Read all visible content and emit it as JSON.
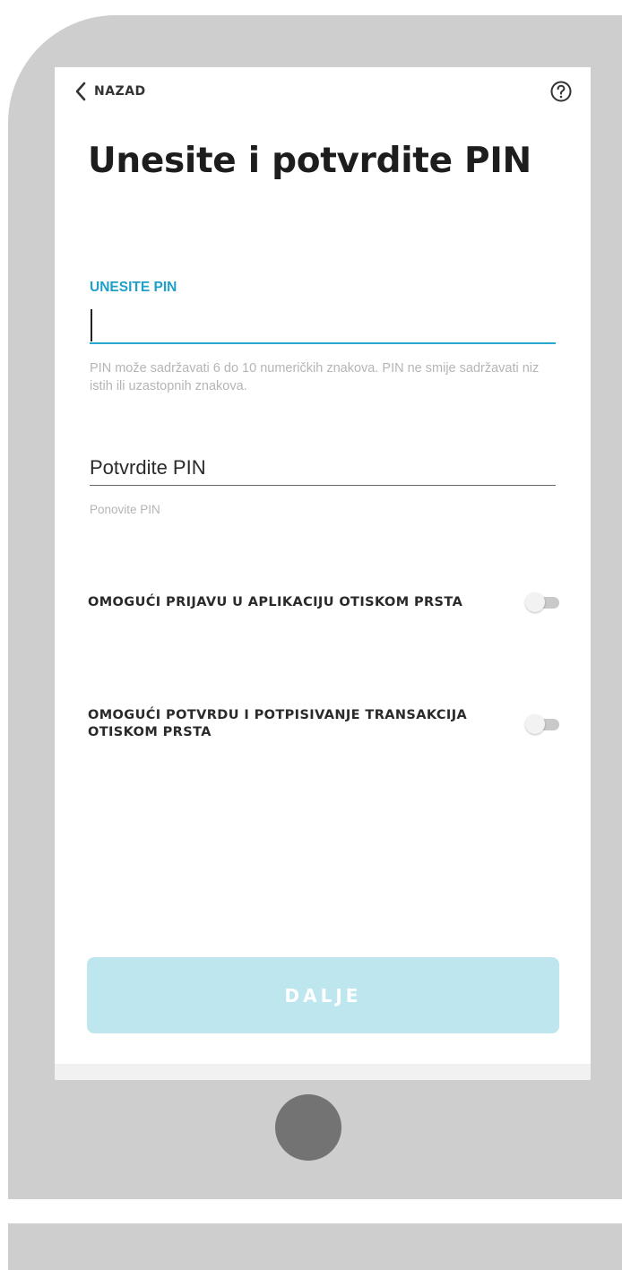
{
  "header": {
    "back_label": "NAZAD",
    "back_icon": "chevron-left-icon",
    "help_icon": "help-circle-icon"
  },
  "page_title": "Unesite i potvrdite PIN",
  "pin_field": {
    "label": "UNESITE PIN",
    "value": "",
    "hint": "PIN može sadržavati 6 do 10 numeričkih znakova. PIN ne smije sadržavati niz istih ili uzastopnih znakova."
  },
  "confirm_field": {
    "placeholder": "Potvrdite PIN",
    "value": "",
    "hint": "Ponovite PIN"
  },
  "toggles": [
    {
      "label": "OMOGUĆI PRIJAVU U APLIKACIJU OTISKOM PRSTA",
      "enabled": false
    },
    {
      "label": "OMOGUĆI POTVRDU I POTPISIVANJE TRANSAKCIJA OTISKOM PRSTA",
      "enabled": false
    }
  ],
  "next_button": {
    "label": "DALJE",
    "disabled": true
  },
  "colors": {
    "accent": "#29a7d1",
    "button_disabled": "#bee6ee",
    "device_frame": "#cdcecd",
    "home_button": "#737373"
  }
}
